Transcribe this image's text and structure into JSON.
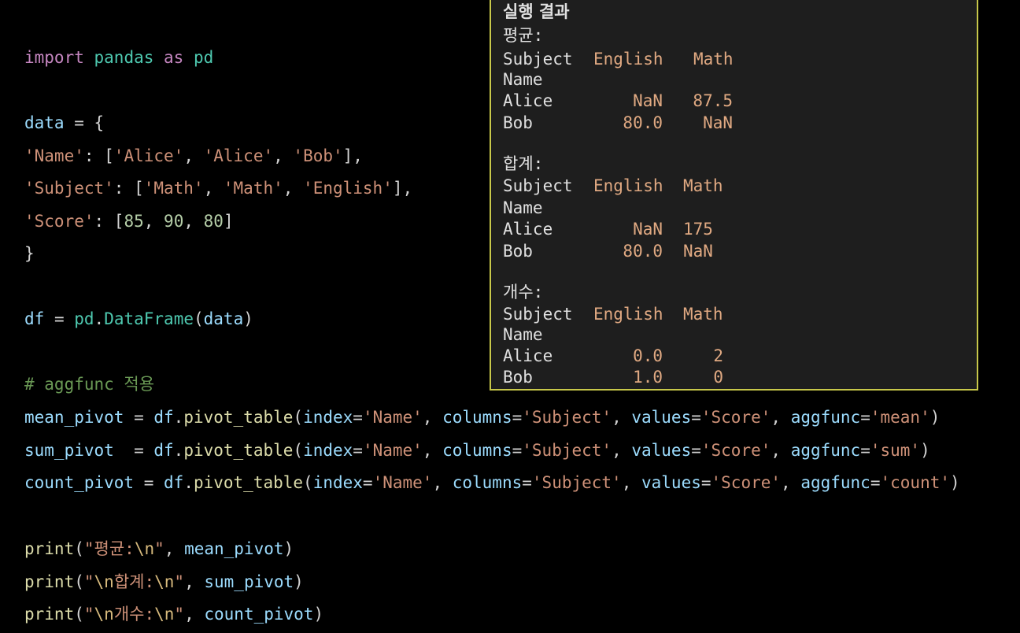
{
  "code": {
    "line1": {
      "kw1": "import",
      "mod": "pandas",
      "kw2": "as",
      "alias": "pd"
    },
    "line2": {
      "var": "data",
      "op": " = {"
    },
    "line3": {
      "key": "'Name'",
      "sep": ": [",
      "v1": "'Alice'",
      "c1": ", ",
      "v2": "'Alice'",
      "c2": ", ",
      "v3": "'Bob'",
      "end": "],"
    },
    "line4": {
      "key": "'Subject'",
      "sep": ": [",
      "v1": "'Math'",
      "c1": ", ",
      "v2": "'Math'",
      "c2": ", ",
      "v3": "'English'",
      "end": "],"
    },
    "line5": {
      "key": "'Score'",
      "sep": ": [",
      "n1": "85",
      "c1": ", ",
      "n2": "90",
      "c2": ", ",
      "n3": "80",
      "end": "]"
    },
    "line6": {
      "text": "}"
    },
    "line7": {
      "var": "df",
      "op": " = ",
      "mod": "pd",
      "dot": ".",
      "fn": "DataFrame",
      "open": "(",
      "arg": "data",
      "close": ")"
    },
    "line8": {
      "comment": "# aggfunc 적용"
    },
    "line9": {
      "var": "mean_pivot",
      "op": " = ",
      "obj": "df",
      "dot": ".",
      "fn": "pivot_table",
      "open": "(",
      "p1": "index",
      "e1": "=",
      "s1": "'Name'",
      "c1": ", ",
      "p2": "columns",
      "e2": "=",
      "s2": "'Subject'",
      "c2": ", ",
      "p3": "values",
      "e3": "=",
      "s3": "'Score'",
      "c3": ", ",
      "p4": "aggfunc",
      "e4": "=",
      "s4": "'mean'",
      "close": ")"
    },
    "line10": {
      "var": "sum_pivot",
      "op": "  = ",
      "obj": "df",
      "dot": ".",
      "fn": "pivot_table",
      "open": "(",
      "p1": "index",
      "e1": "=",
      "s1": "'Name'",
      "c1": ", ",
      "p2": "columns",
      "e2": "=",
      "s2": "'Subject'",
      "c2": ", ",
      "p3": "values",
      "e3": "=",
      "s3": "'Score'",
      "c3": ", ",
      "p4": "aggfunc",
      "e4": "=",
      "s4": "'sum'",
      "close": ")"
    },
    "line11": {
      "var": "count_pivot",
      "op": " = ",
      "obj": "df",
      "dot": ".",
      "fn": "pivot_table",
      "open": "(",
      "p1": "index",
      "e1": "=",
      "s1": "'Name'",
      "c1": ", ",
      "p2": "columns",
      "e2": "=",
      "s2": "'Subject'",
      "c2": ", ",
      "p3": "values",
      "e3": "=",
      "s3": "'Score'",
      "c3": ", ",
      "p4": "aggfunc",
      "e4": "=",
      "s4": "'count'",
      "close": ")"
    },
    "line12": {
      "fn": "print",
      "open": "(",
      "q1": "\"평균:",
      "esc": "\\n",
      "q2": "\"",
      "c": ", ",
      "arg": "mean_pivot",
      "close": ")"
    },
    "line13": {
      "fn": "print",
      "open": "(",
      "q1": "\"",
      "esc1": "\\n",
      "mid": "합계:",
      "esc2": "\\n",
      "q2": "\"",
      "c": ", ",
      "arg": "sum_pivot",
      "close": ")"
    },
    "line14": {
      "fn": "print",
      "open": "(",
      "q1": "\"",
      "esc1": "\\n",
      "mid": "개수:",
      "esc2": "\\n",
      "q2": "\"",
      "c": ", ",
      "arg": "count_pivot",
      "close": ")"
    }
  },
  "output": {
    "title": "실행 결과",
    "mean": {
      "heading": "평균:",
      "header_label": "Subject",
      "col1": "English",
      "col2": "Math",
      "index_name": "Name",
      "rows": [
        {
          "name": "Alice",
          "v1": "NaN",
          "v2": "87.5"
        },
        {
          "name": "Bob",
          "v1": "80.0",
          "v2": "NaN"
        }
      ]
    },
    "sum": {
      "heading": "합계:",
      "header_label": "Subject",
      "col1": "English",
      "col2": "Math",
      "index_name": "Name",
      "rows": [
        {
          "name": "Alice",
          "v1": "NaN",
          "v2": "175"
        },
        {
          "name": "Bob",
          "v1": "80.0",
          "v2": "NaN"
        }
      ]
    },
    "count": {
      "heading": "개수:",
      "header_label": "Subject",
      "col1": "English",
      "col2": "Math",
      "index_name": "Name",
      "rows": [
        {
          "name": "Alice",
          "v1": "0.0",
          "v2": "2"
        },
        {
          "name": "Bob",
          "v1": "1.0",
          "v2": "0"
        }
      ]
    }
  },
  "colors": {
    "background": "#000000",
    "panel_background": "#1e1e1e",
    "panel_border": "#c8c84a"
  }
}
